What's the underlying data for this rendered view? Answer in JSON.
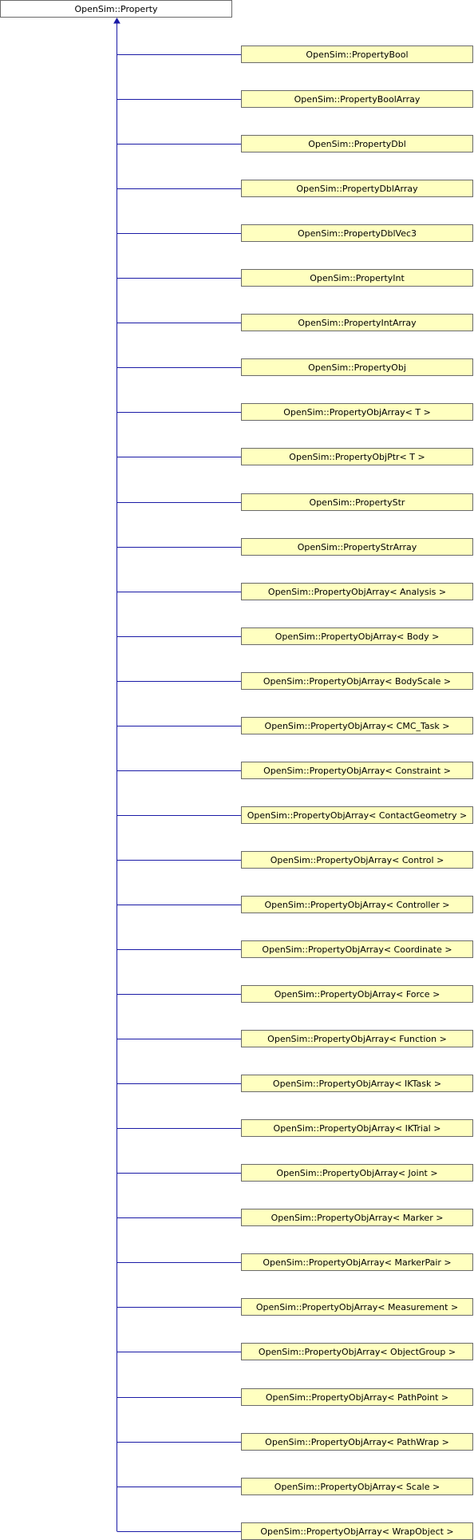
{
  "root": {
    "label": "OpenSim::Property"
  },
  "colors": {
    "edge": "#1a1aa6",
    "child_fill": "#ffffc0",
    "child_border": "#6a6a6a"
  },
  "children": [
    "OpenSim::PropertyBool",
    "OpenSim::PropertyBoolArray",
    "OpenSim::PropertyDbl",
    "OpenSim::PropertyDblArray",
    "OpenSim::PropertyDblVec3",
    "OpenSim::PropertyInt",
    "OpenSim::PropertyIntArray",
    "OpenSim::PropertyObj",
    "OpenSim::PropertyObjArray< T >",
    "OpenSim::PropertyObjPtr< T >",
    "OpenSim::PropertyStr",
    "OpenSim::PropertyStrArray",
    "OpenSim::PropertyObjArray< Analysis >",
    "OpenSim::PropertyObjArray< Body >",
    "OpenSim::PropertyObjArray< BodyScale >",
    "OpenSim::PropertyObjArray< CMC_Task >",
    "OpenSim::PropertyObjArray< Constraint >",
    "OpenSim::PropertyObjArray< ContactGeometry >",
    "OpenSim::PropertyObjArray< Control >",
    "OpenSim::PropertyObjArray< Controller >",
    "OpenSim::PropertyObjArray< Coordinate >",
    "OpenSim::PropertyObjArray< Force >",
    "OpenSim::PropertyObjArray< Function >",
    "OpenSim::PropertyObjArray< IKTask >",
    "OpenSim::PropertyObjArray< IKTrial >",
    "OpenSim::PropertyObjArray< Joint >",
    "OpenSim::PropertyObjArray< Marker >",
    "OpenSim::PropertyObjArray< MarkerPair >",
    "OpenSim::PropertyObjArray< Measurement >",
    "OpenSim::PropertyObjArray< ObjectGroup >",
    "OpenSim::PropertyObjArray< PathPoint >",
    "OpenSim::PropertyObjArray< PathWrap >",
    "OpenSim::PropertyObjArray< Scale >",
    "OpenSim::PropertyObjArray< WrapObject >"
  ]
}
